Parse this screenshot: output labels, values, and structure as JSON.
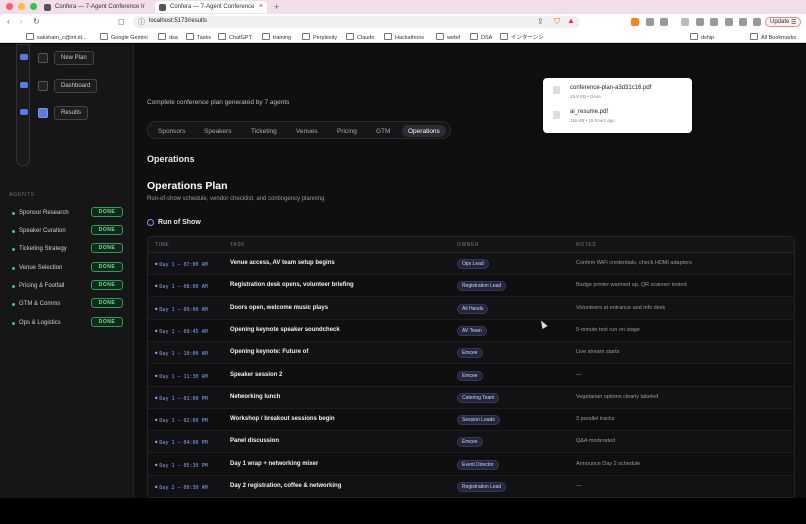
{
  "browser": {
    "tabs": [
      {
        "label": "Confera — 7-Agent Conference Ir"
      },
      {
        "label": "Confera — 7-Agent Conference"
      }
    ],
    "url": "localhost:5173/results",
    "update_label": "Update",
    "bookmarks": [
      "saksham_c@mt.iit...",
      "Google Gemini",
      "dsa",
      "Tasks",
      "ChatGPT",
      "training",
      "Perplexity",
      "Claude",
      "Hackathons",
      "webd",
      "DSA",
      "インターンシ",
      "dship",
      "All Bookmarks"
    ]
  },
  "downloads": [
    {
      "name": "conference-plan-a3d31c16.pdf",
      "meta": "19.8 KB • Done"
    },
    {
      "name": "ai_resume.pdf",
      "meta": "116 KB • 15 hours ago"
    }
  ],
  "sidebar": {
    "steps": [
      {
        "label": "New Plan"
      },
      {
        "label": "Dashboard"
      },
      {
        "label": "Results"
      }
    ],
    "agents_heading": "AGENTS",
    "agents": [
      {
        "name": "Sponsor Research",
        "status": "DONE"
      },
      {
        "name": "Speaker Curation",
        "status": "DONE"
      },
      {
        "name": "Ticketing Strategy",
        "status": "DONE"
      },
      {
        "name": "Venue Selection",
        "status": "DONE"
      },
      {
        "name": "Pricing & Footfall",
        "status": "DONE"
      },
      {
        "name": "GTM & Comms",
        "status": "DONE"
      },
      {
        "name": "Ops & Logistics",
        "status": "DONE"
      }
    ]
  },
  "main": {
    "subtitle": "Complete conference plan generated by 7 agents",
    "tabs": [
      "Sponsors",
      "Speakers",
      "Ticketing",
      "Venues",
      "Pricing",
      "GTM",
      "Operations"
    ],
    "active_tab": "Operations",
    "section_title": "Operations",
    "plan_title": "Operations Plan",
    "plan_desc": "Run-of-show schedule, vendor checklist, and contingency planning",
    "ros_title": "Run of Show",
    "columns": [
      "TIME",
      "TASK",
      "OWNER",
      "NOTES"
    ],
    "rows": [
      {
        "time": "Day 1 — 07:00 AM",
        "task": "Venue access, AV team setup begins",
        "owner": "Ops Lead",
        "notes": "Confirm WiFi credentials, check HDMI adapters"
      },
      {
        "time": "Day 1 — 08:00 AM",
        "task": "Registration desk opens, volunteer briefing",
        "owner": "Registration Lead",
        "notes": "Badge printer warmed up, QR scanner tested"
      },
      {
        "time": "Day 1 — 09:00 AM",
        "task": "Doors open, welcome music plays",
        "owner": "All Hands",
        "notes": "Volunteers at entrance and info desk"
      },
      {
        "time": "Day 1 — 09:45 AM",
        "task": "Opening keynote speaker soundcheck",
        "owner": "AV Team",
        "notes": "5-minute test run on stage"
      },
      {
        "time": "Day 1 — 10:00 AM",
        "task": "Opening keynote: Future of",
        "owner": "Emcee",
        "notes": "Live stream starts"
      },
      {
        "time": "Day 1 — 11:30 AM",
        "task": "Speaker session 2",
        "owner": "Emcee",
        "notes": "—"
      },
      {
        "time": "Day 1 — 01:00 PM",
        "task": "Networking lunch",
        "owner": "Catering Team",
        "notes": "Vegetarian options clearly labeled"
      },
      {
        "time": "Day 1 — 02:00 PM",
        "task": "Workshop / breakout sessions begin",
        "owner": "Session Leads",
        "notes": "3 parallel tracks"
      },
      {
        "time": "Day 1 — 04:00 PM",
        "task": "Panel discussion",
        "owner": "Emcee",
        "notes": "Q&A moderated"
      },
      {
        "time": "Day 1 — 05:30 PM",
        "task": "Day 1 wrap + networking mixer",
        "owner": "Event Director",
        "notes": "Announce Day 2 schedule"
      },
      {
        "time": "Day 2 — 09:30 AM",
        "task": "Day 2 registration, coffee & networking",
        "owner": "Registration Lead",
        "notes": "—"
      }
    ]
  }
}
